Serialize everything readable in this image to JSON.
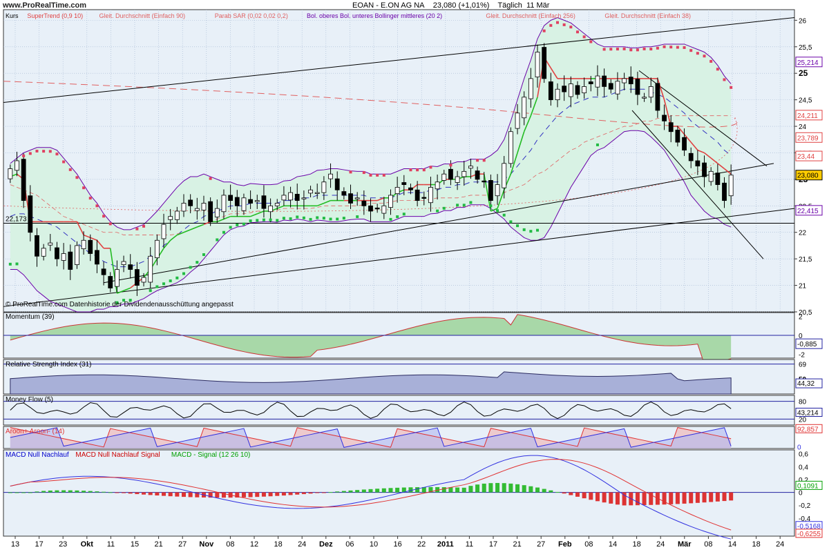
{
  "header": {
    "site": "www.ProRealTime.com",
    "title": "EOAN - E.ON AG NA",
    "price_change": "23,080 (+1,01%)",
    "period": "Täglich",
    "date": "11 Mär"
  },
  "main_legend": [
    {
      "text": "Kurs",
      "color": "#000000"
    },
    {
      "text": "SuperTrend (0,9 10)",
      "color": "#e04040"
    },
    {
      "text": "Gleit. Durchschnitt (Einfach 90)",
      "color": "#e06060"
    },
    {
      "text": "Parab SAR (0,02 0,02 0,2)",
      "color": "#e06060"
    },
    {
      "text": "Bol. oberes Bol. unteres Bollinger mittleres (20 2)",
      "color": "#6a00a8"
    },
    {
      "text": "Gleit. Durchschnitt (Einfach 256)",
      "color": "#e06060"
    },
    {
      "text": "Gleit. Durchschnitt (Einfach 38)",
      "color": "#e06060"
    }
  ],
  "footer_note": "© ProRealTime.com  Datenhistorie der Dividendenausschüttung angepasst",
  "level_label": "22,173",
  "price_axis": {
    "ticks": [
      "26",
      "25,5",
      "25",
      "24,5",
      "24",
      "23,5",
      "23",
      "22,5",
      "22",
      "21,5",
      "21",
      "20,5"
    ],
    "ylim": [
      20.5,
      26.2
    ],
    "badges": [
      {
        "text": "25,214",
        "value": 25.214,
        "color": "#6a00a8",
        "bg": "#ffffff"
      },
      {
        "text": "24,211",
        "value": 24.211,
        "color": "#e04040",
        "bg": "#ffffff"
      },
      {
        "text": "23,789",
        "value": 23.789,
        "color": "#e04040",
        "bg": "#ffffff"
      },
      {
        "text": "23,44",
        "value": 23.44,
        "color": "#e04040",
        "bg": "#ffffff"
      },
      {
        "text": "23,080",
        "value": 23.08,
        "color": "#000000",
        "bg": "#ffcc00"
      },
      {
        "text": "22,415",
        "value": 22.415,
        "color": "#6a00a8",
        "bg": "#ffffff"
      }
    ]
  },
  "x_axis": {
    "labels": [
      "13",
      "17",
      "23",
      "Okt",
      "11",
      "15",
      "21",
      "27",
      "Nov",
      "08",
      "12",
      "18",
      "24",
      "Dez",
      "06",
      "10",
      "16",
      "22",
      "2011",
      "11",
      "17",
      "21",
      "27",
      "Feb",
      "08",
      "14",
      "18",
      "24",
      "Mär",
      "08",
      "14",
      "18",
      "24"
    ],
    "bold": [
      "Okt",
      "Nov",
      "Dez",
      "2011",
      "Feb",
      "Mär"
    ]
  },
  "panels": {
    "momentum": {
      "title": "Momentum (39)",
      "ticks": [
        "2",
        "0",
        "-2"
      ],
      "ylim": [
        -2.4,
        2.4
      ],
      "value_label": "-0,885"
    },
    "rsi": {
      "title": "Relative Strength Index (31)",
      "ticks": [
        "69",
        "50"
      ],
      "ylim": [
        30,
        75
      ],
      "value_label": "44,32"
    },
    "mfi": {
      "title": "Money Flow (5)",
      "ticks": [
        "80",
        "20"
      ],
      "ylim": [
        0,
        100
      ],
      "value_label": "43,214"
    },
    "aroon": {
      "title": "Aroon+ Aroon- (14)",
      "ticks": [],
      "ylim": [
        0,
        100
      ],
      "value_label": "92,857",
      "value_label2": "0"
    },
    "macd": {
      "title_parts": [
        {
          "text": "MACD Null Nachlauf",
          "color": "#0000cc"
        },
        {
          "text": "MACD Null Nachlauf Signal",
          "color": "#cc0000"
        },
        {
          "text": "MACD - Signal (12 26 10)",
          "color": "#00a000"
        }
      ],
      "ticks": [
        "0,6",
        "0,4",
        "0,2",
        "0",
        "-0,2",
        "-0,4",
        "-0,6"
      ],
      "ylim": [
        -0.68,
        0.66
      ],
      "value_label": "0,1091",
      "value_label2": "-0,5168",
      "value_label3": "-0,6255"
    }
  },
  "colors": {
    "panel_bg": "#e8f0f8",
    "grid": "#9fb3d0",
    "bb_fill": "#d8f2e4",
    "bb_line": "#6a00a8",
    "supertrend_up": "#22bb22",
    "supertrend_down": "#e04040",
    "sar_up": "#22bb44",
    "sar_down": "#e04060",
    "ma": "#e06060",
    "mom_up_fill": "#a8d8a8",
    "mom_dn_fill": "#d8a8a8",
    "rsi_fill": "#a8b0d8",
    "macd_blue": "#3030e0",
    "macd_red": "#e03030",
    "hist_up": "#33bb33",
    "hist_dn": "#dd3333"
  },
  "chart_data": {
    "type": "candlestick",
    "ylim": [
      20.5,
      26.2
    ],
    "closes": [
      23.2,
      23.35,
      22.6,
      22.0,
      21.55,
      21.7,
      21.8,
      21.5,
      21.6,
      21.3,
      21.75,
      21.85,
      21.6,
      21.4,
      21.2,
      20.95,
      21.3,
      21.45,
      21.3,
      21.0,
      21.15,
      21.55,
      21.85,
      22.15,
      22.3,
      22.4,
      22.55,
      22.5,
      22.45,
      22.55,
      22.2,
      22.45,
      22.7,
      22.6,
      22.5,
      22.65,
      22.55,
      22.6,
      22.45,
      22.5,
      22.55,
      22.7,
      22.75,
      22.6,
      22.65,
      22.8,
      22.75,
      22.95,
      23.1,
      22.8,
      22.7,
      22.55,
      22.65,
      22.5,
      22.4,
      22.45,
      22.5,
      22.7,
      22.85,
      22.9,
      22.8,
      22.6,
      22.65,
      22.85,
      22.95,
      23.1,
      23.0,
      23.05,
      23.15,
      23.25,
      23.0,
      22.95,
      22.6,
      22.9,
      23.3,
      23.9,
      24.25,
      24.55,
      24.9,
      25.4,
      24.9,
      24.5,
      24.7,
      24.65,
      24.8,
      24.6,
      24.75,
      24.8,
      24.95,
      24.75,
      24.7,
      24.85,
      24.9,
      24.8,
      24.6,
      24.55,
      24.75,
      24.3,
      24.1,
      23.9,
      23.7,
      23.55,
      23.35,
      23.25,
      23.05,
      23.15,
      22.9,
      22.6,
      23.08
    ],
    "supertrend": [
      23.05,
      23.1,
      23.0,
      22.2,
      22.2,
      22.2,
      22.2,
      22.2,
      22.2,
      22.2,
      22.2,
      21.95,
      21.9,
      21.85,
      21.7,
      21.7,
      20.85,
      20.9,
      20.95,
      21.05,
      21.15,
      21.3,
      21.5,
      21.7,
      21.85,
      21.95,
      22.0,
      22.05,
      22.1,
      22.15,
      22.2,
      22.2,
      22.25,
      22.3,
      22.3,
      22.3,
      22.3,
      22.35,
      22.4,
      22.4,
      22.45,
      22.5,
      22.5,
      22.5,
      22.5,
      22.5,
      22.5,
      22.55,
      22.6,
      22.6,
      22.6,
      22.6,
      22.6,
      22.6,
      22.6,
      22.6,
      22.65,
      22.65,
      22.75,
      22.8,
      22.8,
      22.9,
      22.9,
      22.9,
      22.9,
      23.0,
      23.0,
      23.0,
      23.05,
      23.05,
      23.1,
      23.1,
      22.4,
      22.45,
      22.8,
      23.1,
      23.5,
      23.9,
      24.2,
      24.55,
      25.3,
      25.1,
      24.9,
      24.9,
      24.9,
      24.9,
      24.9,
      24.9,
      24.9,
      24.9,
      24.9,
      24.9,
      24.9,
      24.9,
      24.9,
      24.9,
      24.9,
      24.9,
      24.5,
      24.0,
      24.0,
      23.85,
      23.7,
      23.55,
      23.5,
      23.4,
      23.3,
      23.2,
      23.1
    ],
    "bb_mid": [
      22.3,
      22.35,
      22.35,
      22.3,
      22.25,
      22.2,
      22.15,
      22.1,
      22.0,
      21.9,
      21.8,
      21.7,
      21.6,
      21.55,
      21.45,
      21.4,
      21.35,
      21.35,
      21.35,
      21.4,
      21.45,
      21.55,
      21.65,
      21.75,
      21.85,
      21.95,
      22.05,
      22.15,
      22.2,
      22.3,
      22.35,
      22.4,
      22.45,
      22.5,
      22.5,
      22.5,
      22.55,
      22.55,
      22.55,
      22.55,
      22.55,
      22.6,
      22.6,
      22.65,
      22.65,
      22.65,
      22.7,
      22.7,
      22.7,
      22.7,
      22.7,
      22.7,
      22.7,
      22.7,
      22.65,
      22.65,
      22.65,
      22.65,
      22.7,
      22.75,
      22.75,
      22.75,
      22.75,
      22.8,
      22.8,
      22.85,
      22.85,
      22.9,
      22.9,
      22.95,
      22.95,
      22.95,
      22.95,
      22.95,
      23.0,
      23.1,
      23.25,
      23.4,
      23.55,
      23.75,
      23.9,
      24.05,
      24.2,
      24.3,
      24.4,
      24.45,
      24.5,
      24.55,
      24.55,
      24.55,
      24.6,
      24.65,
      24.7,
      24.7,
      24.7,
      24.7,
      24.65,
      24.6,
      24.55,
      24.45,
      24.35,
      24.25,
      24.1,
      24.0,
      23.9,
      23.8,
      23.7,
      23.55,
      23.45
    ],
    "bb_width": [
      1.0,
      1.05,
      1.15,
      1.25,
      1.35,
      1.4,
      1.45,
      1.45,
      1.4,
      1.35,
      1.3,
      1.2,
      1.1,
      1.0,
      0.9,
      0.8,
      0.75,
      0.7,
      0.7,
      0.7,
      0.7,
      0.72,
      0.75,
      0.8,
      0.85,
      0.9,
      0.92,
      0.9,
      0.85,
      0.8,
      0.7,
      0.6,
      0.5,
      0.45,
      0.4,
      0.38,
      0.37,
      0.36,
      0.35,
      0.35,
      0.36,
      0.37,
      0.38,
      0.4,
      0.42,
      0.45,
      0.47,
      0.48,
      0.5,
      0.5,
      0.48,
      0.46,
      0.45,
      0.45,
      0.45,
      0.45,
      0.45,
      0.45,
      0.45,
      0.45,
      0.45,
      0.45,
      0.45,
      0.45,
      0.44,
      0.44,
      0.44,
      0.43,
      0.43,
      0.43,
      0.43,
      0.43,
      0.5,
      0.6,
      0.75,
      1.0,
      1.25,
      1.5,
      1.7,
      1.9,
      2.0,
      1.95,
      1.85,
      1.7,
      1.55,
      1.4,
      1.25,
      1.1,
      1.0,
      0.95,
      0.9,
      0.85,
      0.8,
      0.78,
      0.78,
      0.8,
      0.85,
      0.92,
      1.0,
      1.1,
      1.2,
      1.3,
      1.4,
      1.45,
      1.5,
      1.5,
      1.45,
      1.4,
      1.35
    ],
    "ma90_x": [
      0,
      108
    ],
    "ma90_y": [
      24.9,
      23.1
    ],
    "ma38": [
      22.9,
      22.85,
      22.8,
      22.75,
      22.7,
      22.6,
      22.5,
      22.4,
      22.3,
      22.25,
      22.2,
      22.15,
      22.1,
      22.05,
      22.0,
      22.0,
      22.0,
      21.95,
      21.95,
      21.95,
      21.95,
      21.95,
      21.95,
      21.95,
      21.95,
      21.97,
      22.0,
      22.05,
      22.1,
      22.15,
      22.2,
      22.25,
      22.3,
      22.35,
      22.35,
      22.35,
      22.37,
      22.4,
      22.4,
      22.4,
      22.42,
      22.45,
      22.45,
      22.45,
      22.45,
      22.45,
      22.47,
      22.5,
      22.5,
      22.5,
      22.5,
      22.5,
      22.5,
      22.52,
      22.55,
      22.55,
      22.55,
      22.57,
      22.6,
      22.6,
      22.6,
      22.6,
      22.6,
      22.62,
      22.65,
      22.65,
      22.65,
      22.65,
      22.67,
      22.7,
      22.7,
      22.7,
      22.7,
      22.72,
      22.75,
      22.8,
      22.85,
      22.9,
      23.0,
      23.1,
      23.15,
      23.25,
      23.35,
      23.45,
      23.55,
      23.6,
      23.7,
      23.75,
      23.8,
      23.85,
      23.9,
      23.95,
      24.0,
      24.0,
      24.05,
      24.1,
      24.1,
      24.15,
      24.15,
      24.2,
      24.2,
      24.2,
      24.2,
      24.2,
      24.2,
      24.2,
      24.2,
      24.2,
      24.2
    ]
  }
}
